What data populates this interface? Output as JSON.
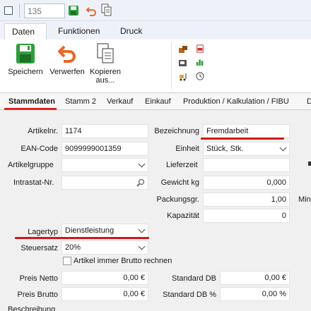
{
  "quick_access": {
    "record_number": "135"
  },
  "ribbon_tabs": [
    "Daten",
    "Funktionen",
    "Druck"
  ],
  "ribbon": {
    "save_label": "Speichern",
    "discard_label": "Verwerfen",
    "copy_label_line1": "Kopieren",
    "copy_label_line2": "aus..."
  },
  "content_tabs": [
    "Stammdaten",
    "Stamm 2",
    "Verkauf",
    "Einkauf",
    "Produktion / Kalkulation / FIBU",
    "D"
  ],
  "form": {
    "artikelnr_label": "Artikelnr.",
    "artikelnr": "1174",
    "ean_label": "EAN-Code",
    "ean": "9099999001359",
    "artikelgruppe_label": "Artikelgruppe",
    "artikelgruppe": "",
    "intrastat_label": "Intrastat-Nr.",
    "intrastat": "",
    "bezeichnung_label": "Bezeichnung",
    "bezeichnung": "Fremdarbeit",
    "einheit_label": "Einheit",
    "einheit": "Stück, Stk.",
    "lieferzeit_label": "Lieferzeit",
    "lieferzeit": "",
    "gewicht_label": "Gewicht kg",
    "gewicht": "0,000",
    "packungsgr_label": "Packungsgr.",
    "packungsgr": "1,00",
    "kapazitaet_label": "Kapazität",
    "kapazitaet": "0",
    "min_label": "Min",
    "lagertyp_label": "Lagertyp",
    "lagertyp": "Dienstleistung",
    "steuersatz_label": "Steuersatz",
    "steuersatz": "20%",
    "brutto_checkbox_label": "Artikel immer Brutto rechnen",
    "preis_netto_label": "Preis Netto",
    "preis_netto": "0,00 €",
    "preis_brutto_label": "Preis Brutto",
    "preis_brutto": "0,00 €",
    "standard_db_label": "Standard DB",
    "standard_db": "0,00 €",
    "standard_db_pct_label": "Standard DB %",
    "standard_db_pct": "0,00 %",
    "beschreibung_label": "Beschreibung"
  },
  "colors": {
    "accent_red": "#d01818",
    "save_green": "#2e9e3a",
    "discard_orange": "#e8672a"
  }
}
